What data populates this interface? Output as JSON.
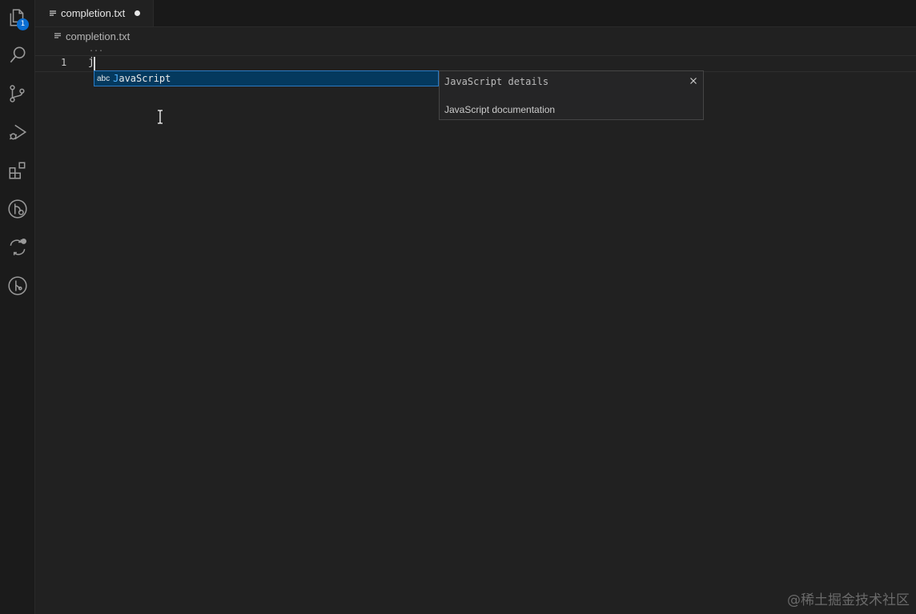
{
  "activity_bar": {
    "items": [
      {
        "icon": "files-icon",
        "badge": "1"
      },
      {
        "icon": "search-icon"
      },
      {
        "icon": "source-control-icon"
      },
      {
        "icon": "run-debug-icon"
      },
      {
        "icon": "extensions-icon"
      },
      {
        "icon": "git-graph-icon"
      },
      {
        "icon": "remote-sync-icon"
      },
      {
        "icon": "git-branch-icon"
      }
    ]
  },
  "tab": {
    "filename": "completion.txt",
    "dirty": true
  },
  "breadcrumb": {
    "filename": "completion.txt"
  },
  "editor": {
    "ellipsis": "...",
    "line_number": "1",
    "code": "j"
  },
  "suggest": {
    "kind": "abc",
    "label_highlight": "J",
    "label_rest": "avaScript"
  },
  "details": {
    "title": "JavaScript details",
    "documentation": "JavaScript documentation"
  },
  "watermark": "@稀土掘金技术社区",
  "colors": {
    "badge": "#0a6ed1",
    "selection": "#04395e",
    "highlight": "#4fb3ff"
  }
}
